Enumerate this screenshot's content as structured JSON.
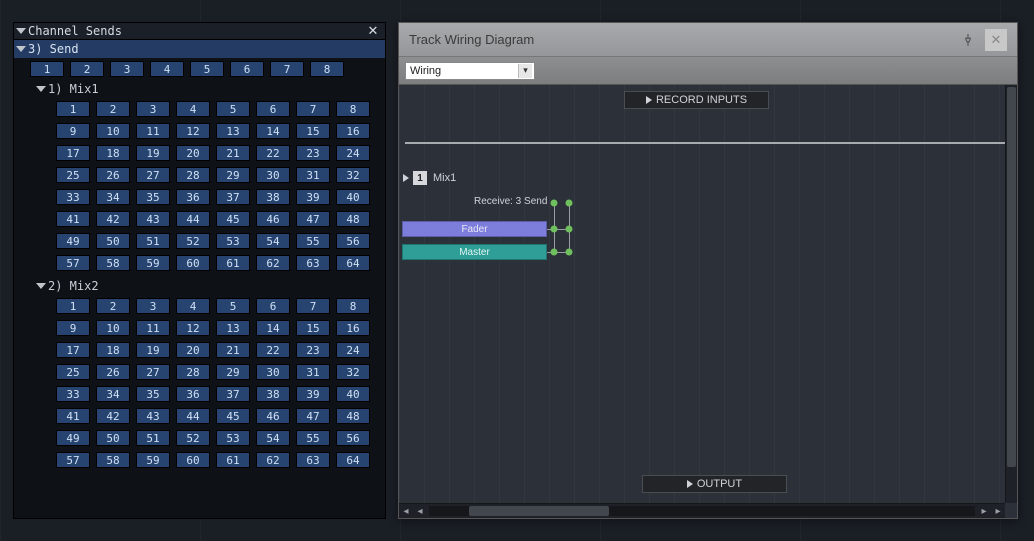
{
  "channel_sends": {
    "title": "Channel Sends",
    "send_header": "3) Send",
    "top_row": [
      "1",
      "2",
      "3",
      "4",
      "5",
      "6",
      "7",
      "8"
    ],
    "mixes": [
      {
        "label": "1) Mix1",
        "cells": [
          "1",
          "2",
          "3",
          "4",
          "5",
          "6",
          "7",
          "8",
          "9",
          "10",
          "11",
          "12",
          "13",
          "14",
          "15",
          "16",
          "17",
          "18",
          "19",
          "20",
          "21",
          "22",
          "23",
          "24",
          "25",
          "26",
          "27",
          "28",
          "29",
          "30",
          "31",
          "32",
          "33",
          "34",
          "35",
          "36",
          "37",
          "38",
          "39",
          "40",
          "41",
          "42",
          "43",
          "44",
          "45",
          "46",
          "47",
          "48",
          "49",
          "50",
          "51",
          "52",
          "53",
          "54",
          "55",
          "56",
          "57",
          "58",
          "59",
          "60",
          "61",
          "62",
          "63",
          "64"
        ]
      },
      {
        "label": "2) Mix2",
        "cells": [
          "1",
          "2",
          "3",
          "4",
          "5",
          "6",
          "7",
          "8",
          "9",
          "10",
          "11",
          "12",
          "13",
          "14",
          "15",
          "16",
          "17",
          "18",
          "19",
          "20",
          "21",
          "22",
          "23",
          "24",
          "25",
          "26",
          "27",
          "28",
          "29",
          "30",
          "31",
          "32",
          "33",
          "34",
          "35",
          "36",
          "37",
          "38",
          "39",
          "40",
          "41",
          "42",
          "43",
          "44",
          "45",
          "46",
          "47",
          "48",
          "49",
          "50",
          "51",
          "52",
          "53",
          "54",
          "55",
          "56",
          "57",
          "58",
          "59",
          "60",
          "61",
          "62",
          "63",
          "64"
        ]
      }
    ]
  },
  "wiring": {
    "title": "Track Wiring Diagram",
    "dropdown_value": "Wiring",
    "record_inputs": "RECORD INPUTS",
    "output": "OUTPUT",
    "track": {
      "num": "1",
      "name": "Mix1",
      "receive_label": "Receive: 3 Send",
      "fader": "Fader",
      "master": "Master"
    }
  }
}
